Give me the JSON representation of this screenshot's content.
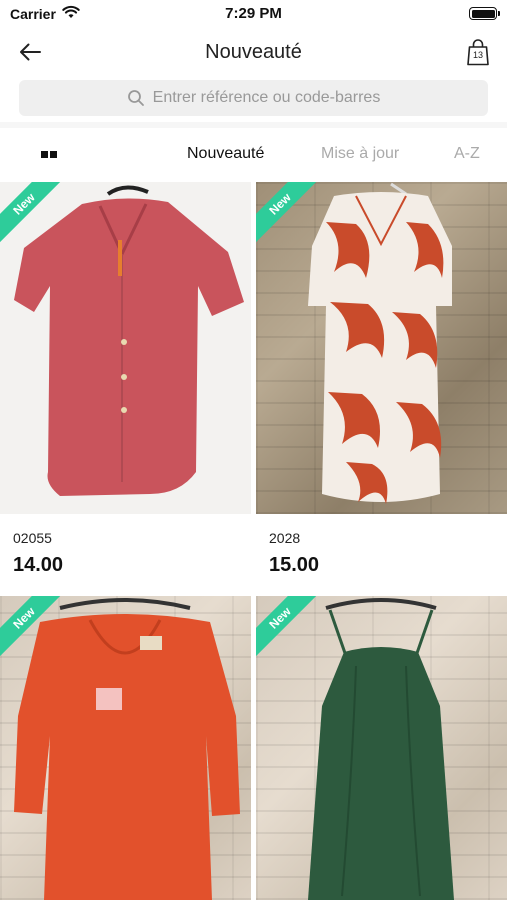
{
  "status_bar": {
    "carrier": "Carrier",
    "time": "7:29 PM"
  },
  "nav": {
    "title": "Nouveauté",
    "back_icon": "arrow-left-icon",
    "cart_icon": "shopping-bag-icon",
    "cart_count": "13"
  },
  "search": {
    "placeholder": "Entrer référence ou code-barres",
    "icon": "search-icon"
  },
  "sort": {
    "view_toggle_icon": "grid-view-icon",
    "tabs": [
      {
        "label": "Nouveauté",
        "active": true
      },
      {
        "label": "Mise à jour",
        "active": false
      },
      {
        "label": "A-Z",
        "active": false
      }
    ]
  },
  "products": [
    {
      "badge": "New",
      "reference": "02055",
      "price": "14.00",
      "color": "#c9545c"
    },
    {
      "badge": "New",
      "reference": "2028",
      "price": "15.00",
      "color": "#d4532e"
    },
    {
      "badge": "New",
      "reference": "",
      "price": "",
      "color": "#e2512c"
    },
    {
      "badge": "New",
      "reference": "",
      "price": "",
      "color": "#2d5a3e"
    }
  ],
  "colors": {
    "badge": "#2ecc9a",
    "search_bg": "#efefef",
    "inactive_tab": "#aaaaaa"
  }
}
